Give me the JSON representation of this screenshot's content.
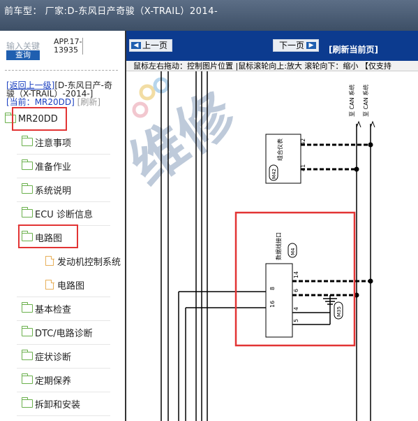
{
  "header": {
    "title": "前车型： 厂家:D-东风日产奇骏（X-TRAIL）2014-"
  },
  "search": {
    "label": "输入关键",
    "button": "查询"
  },
  "app_code": "APP.17-13935",
  "breadcrumb": {
    "back": "[返回上一级]",
    "path": "[D-东风日产-奇骏（X-TRAIL）-2014-]",
    "current_label": "[当前：",
    "current": "MR20DD]",
    "refresh": "[刷新]"
  },
  "tree": {
    "root": "MR20DD",
    "items": [
      {
        "label": "注意事项"
      },
      {
        "label": "准备作业"
      },
      {
        "label": "系统说明"
      },
      {
        "label": "ECU 诊断信息"
      },
      {
        "label": "电路图",
        "children": [
          {
            "label": "发动机控制系统"
          },
          {
            "label": "电路图"
          }
        ]
      },
      {
        "label": "基本检查"
      },
      {
        "label": "DTC/电路诊断"
      },
      {
        "label": "症状诊断"
      },
      {
        "label": "定期保养"
      },
      {
        "label": "拆卸和安装"
      }
    ]
  },
  "viewer": {
    "prev": "上一页",
    "next": "下一页",
    "refresh": "[刷新当前页]",
    "hint": "鼠标左右拖动：控制图片位置 |鼠标滚轮向上:放大  滚轮向下：缩小 【仅支持"
  },
  "diagram": {
    "meter_name": "组合仪表",
    "meter_code": "M42",
    "meter_pins": [
      "42",
      "41"
    ],
    "dlc_name": "数据线接口",
    "dlc_code": "M4",
    "dlc_right_pins": [
      "14",
      "6",
      "4",
      "5"
    ],
    "dlc_left_pins": [
      "8",
      "16"
    ],
    "ground_code": "M35",
    "can_labels": [
      "至 CAN 系统",
      "至 CAN 系统"
    ],
    "watermark": "维修"
  },
  "colors": {
    "title_bar": "#4a5c74",
    "toolbar": "#0c3b8f",
    "highlight": "#e23434",
    "folder": "#6ab04c"
  }
}
